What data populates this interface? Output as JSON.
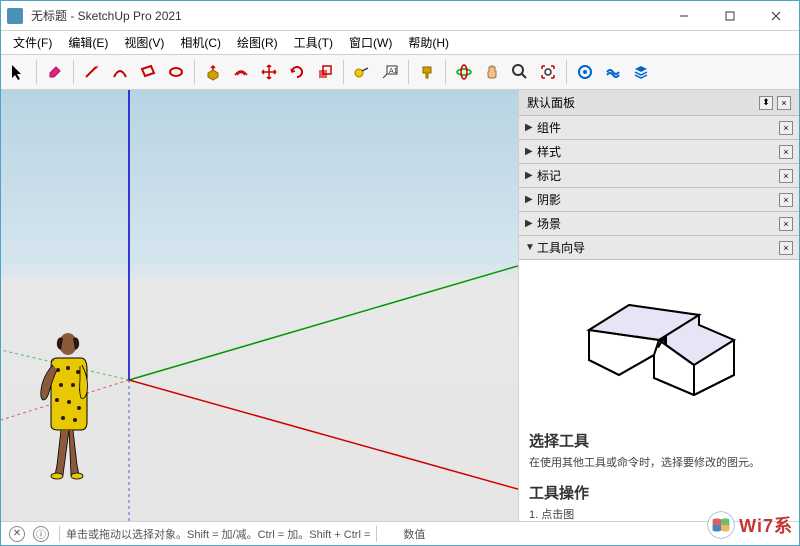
{
  "window": {
    "title": "无标题 - SketchUp Pro 2021"
  },
  "menu": {
    "file": "文件(F)",
    "edit": "编辑(E)",
    "view": "视图(V)",
    "camera": "相机(C)",
    "draw": "绘图(R)",
    "tools": "工具(T)",
    "window": "窗口(W)",
    "help": "帮助(H)"
  },
  "panel": {
    "title": "默认面板",
    "sections": {
      "components": "组件",
      "styles": "样式",
      "tags": "标记",
      "shadows": "阴影",
      "scenes": "场景",
      "instructor": "工具向导"
    }
  },
  "instructor": {
    "heading": "选择工具",
    "desc": "在使用其他工具或命令时，选择要修改的图元。",
    "opheading": "工具操作",
    "opdesc": "1. 点击图"
  },
  "status": {
    "hint": "单击或拖动以选择对象。Shift = 加/减。Ctrl = 加。Shift + Ctrl = ",
    "measure_label": "数值"
  },
  "watermark": {
    "text": "Wi7系"
  }
}
